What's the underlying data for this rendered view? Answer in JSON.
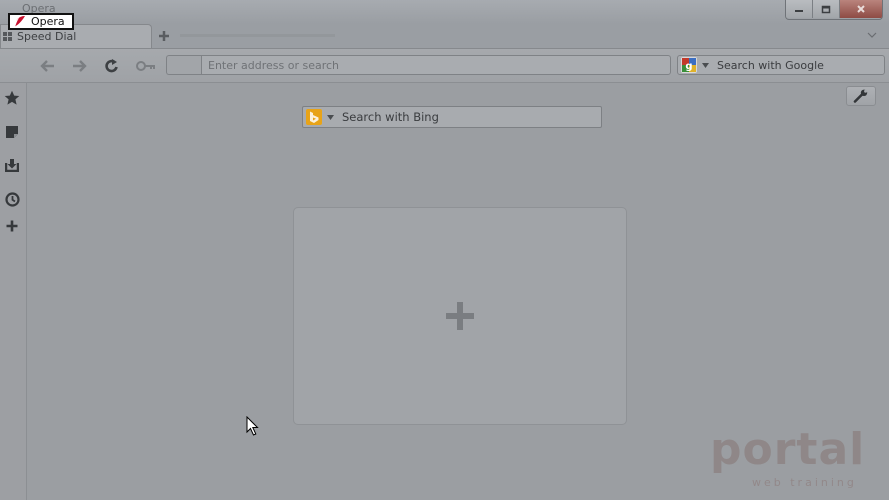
{
  "window": {
    "title": "Opera",
    "menu_label": "Opera"
  },
  "tabs": [
    {
      "label": "Speed Dial",
      "active": true
    }
  ],
  "toolbar": {
    "address_placeholder": "Enter address or search",
    "search_placeholder": "Search with Google",
    "search_engine_icon": "google-icon"
  },
  "speed_dial": {
    "search_placeholder": "Search with Bing",
    "search_engine_icon": "bing-icon",
    "add_tile_icon": "plus-icon"
  },
  "sidebar": {
    "items": [
      {
        "icon": "star-icon"
      },
      {
        "icon": "notes-icon"
      },
      {
        "icon": "downloads-icon"
      },
      {
        "icon": "history-icon"
      },
      {
        "icon": "plus-icon"
      }
    ]
  },
  "watermark": {
    "brand": "portal",
    "tagline": "web training"
  },
  "colors": {
    "overlay": "#9b9ea2",
    "close_button": "#8e4b44",
    "bing_orange": "#e8a317"
  }
}
